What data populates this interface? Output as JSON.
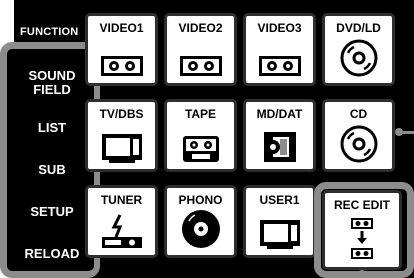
{
  "panel": {
    "function_label": "FUNCTION"
  },
  "sidebar": {
    "items": [
      {
        "lines": [
          "SOUND",
          "FIELD"
        ]
      },
      {
        "lines": [
          "LIST"
        ]
      },
      {
        "lines": [
          "SUB"
        ]
      },
      {
        "lines": [
          "SETUP"
        ]
      },
      {
        "lines": [
          "RELOAD"
        ]
      }
    ]
  },
  "grid": {
    "buttons": [
      {
        "label": "VIDEO1",
        "icon": "cassette-icon"
      },
      {
        "label": "VIDEO2",
        "icon": "cassette-icon"
      },
      {
        "label": "VIDEO3",
        "icon": "cassette-icon"
      },
      {
        "label": "DVD/LD",
        "icon": "disc-icon"
      },
      {
        "label": "TV/DBS",
        "icon": "tv-icon"
      },
      {
        "label": "TAPE",
        "icon": "tape-icon"
      },
      {
        "label": "MD/DAT",
        "icon": "minidisc-icon"
      },
      {
        "label": "CD",
        "icon": "disc-icon"
      },
      {
        "label": "TUNER",
        "icon": "tuner-icon"
      },
      {
        "label": "PHONO",
        "icon": "record-icon"
      },
      {
        "label": "USER1",
        "icon": "tv-icon"
      },
      {
        "label": "REC EDIT",
        "icon": "rec-edit-icon"
      }
    ]
  },
  "colors": {
    "panel_bg": "#000000",
    "button_bg": "#ffffff",
    "highlight_frame": "#8c8c8c"
  }
}
